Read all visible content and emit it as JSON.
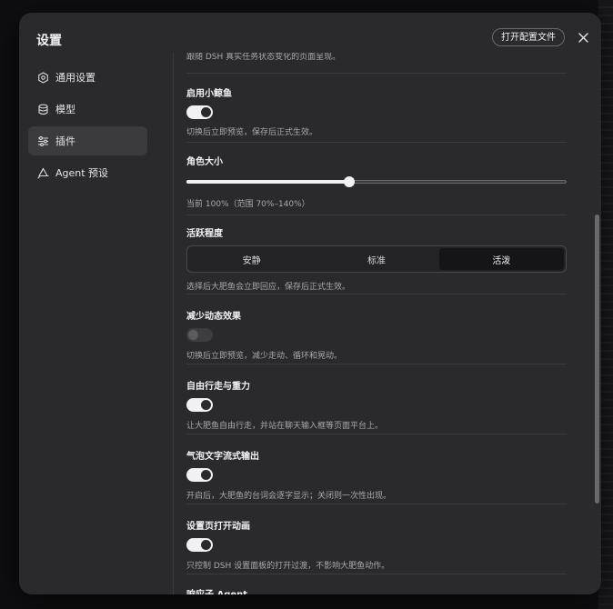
{
  "dialog": {
    "title": "设置",
    "open_config_label": "打开配置文件"
  },
  "sidebar": {
    "items": [
      {
        "label": "通用设置",
        "icon": "gear-icon",
        "active": false
      },
      {
        "label": "模型",
        "icon": "database-icon",
        "active": false
      },
      {
        "label": "插件",
        "icon": "sliders-icon",
        "active": true
      },
      {
        "label": "Agent 预设",
        "icon": "recycle-icon",
        "active": false
      }
    ]
  },
  "content": {
    "top_desc": "跟随 DSH 真实任务状态变化的页面呈现。",
    "enable_shark": {
      "title": "启用小鲸鱼",
      "enabled": true,
      "desc": "切换后立即预览，保存后正式生效。"
    },
    "character_size": {
      "title": "角色大小",
      "value_percent": 100,
      "min_percent": 70,
      "max_percent": 140,
      "desc": "当前 100%（范围 70%–140%）"
    },
    "activity": {
      "title": "活跃程度",
      "options": [
        "安静",
        "标准",
        "活泼"
      ],
      "selected": "活泼",
      "desc": "选择后大肥鱼会立即回应，保存后正式生效。"
    },
    "reduce_motion": {
      "title": "减少动态效果",
      "enabled": false,
      "desc": "切换后立即预览，减少走动、循环和晃动。"
    },
    "free_walk": {
      "title": "自由行走与重力",
      "enabled": true,
      "desc": "让大肥鱼自由行走，并站在聊天输入框等页面平台上。"
    },
    "bubble_stream": {
      "title": "气泡文字流式输出",
      "enabled": true,
      "desc": "开启后，大肥鱼的台词会逐字显示；关闭则一次性出现。"
    },
    "settings_anim": {
      "title": "设置页打开动画",
      "enabled": true,
      "desc": "只控制 DSH 设置面板的打开过渡，不影响大肥鱼动作。"
    },
    "respond_agent": {
      "title": "响应子 Agent"
    }
  }
}
